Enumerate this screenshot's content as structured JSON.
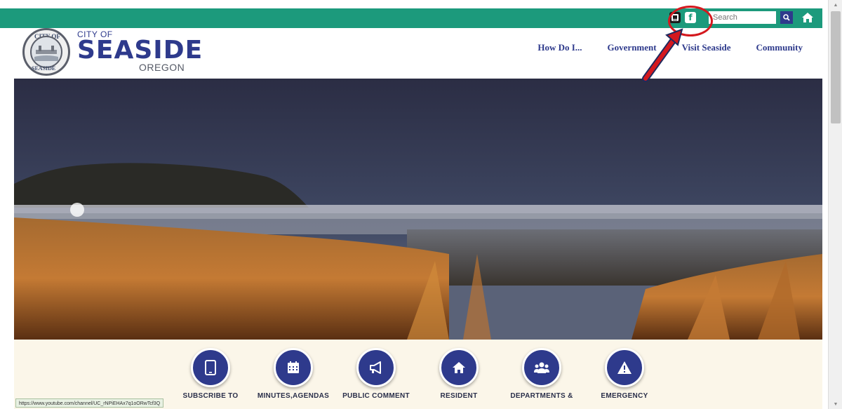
{
  "topbar": {
    "search_placeholder": "Search",
    "colors": {
      "bar": "#1c9a7c"
    }
  },
  "brand": {
    "seal_top": "CITY OF",
    "seal_bottom": "SEASIDE",
    "city_of": "CITY OF",
    "name": "SEASIDE",
    "state": "OREGON"
  },
  "nav": {
    "items": [
      {
        "label": "How Do I..."
      },
      {
        "label": "Government"
      },
      {
        "label": "Visit Seaside"
      },
      {
        "label": "Community"
      }
    ]
  },
  "tiles": [
    {
      "label": "SUBSCRIBE TO",
      "icon": "tablet-icon"
    },
    {
      "label": "MINUTES,AGENDAS",
      "icon": "calendar-icon"
    },
    {
      "label": "PUBLIC COMMENT",
      "icon": "megaphone-icon"
    },
    {
      "label": "RESIDENT",
      "icon": "home-icon"
    },
    {
      "label": "DEPARTMENTS &",
      "icon": "users-icon"
    },
    {
      "label": "EMERGENCY",
      "icon": "warning-icon"
    }
  ],
  "status_url": "https://www.youtube.com/channel/UC_rNPiEHAx7q1oORwTcf3Q",
  "accent": {
    "primary": "#2e3a8c",
    "annotation": "#d4181e"
  }
}
